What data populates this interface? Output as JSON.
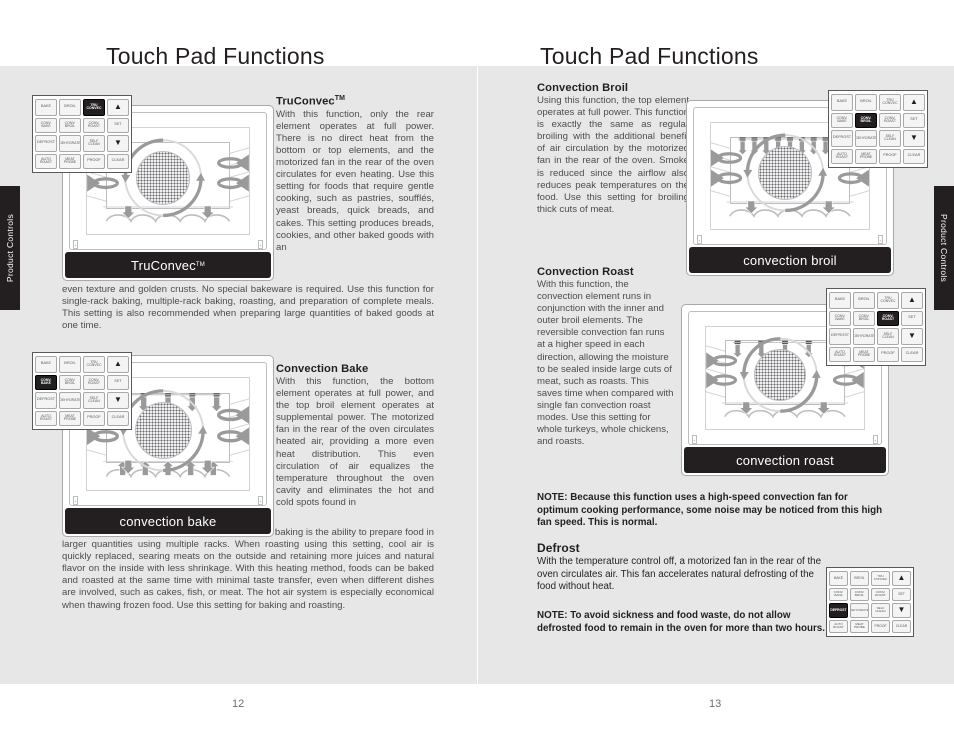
{
  "document": {
    "side_tab_left": "Product Controls",
    "side_tab_right": "Product Controls"
  },
  "left_page": {
    "heading": "Touch Pad Functions",
    "folio": "12",
    "sections": [
      {
        "title": "TruConvec",
        "title_sup": "TM",
        "column_text": "With this function, only the rear element operates at full power. There is no direct heat from the bottom or top elements, and the motorized fan in the rear of the oven circulates for even heating. Use this setting for foods that require gentle cooking, such as pastries, soufflés, yeast breads, quick breads, and cakes. This setting produces breads, cookies, and other baked goods with an",
        "full_text": "even texture and golden crusts. No special bakeware is required. Use this function for single-rack baking, multiple-rack baking, roasting, and preparation of complete meals. This setting is also recommended when preparing large quantities of baked goods at one time."
      },
      {
        "title": "Convection Bake",
        "column_text": "With this function, the bottom element operates at full power, and the top broil element operates at supplemental power. The motorized fan in the rear of the oven circulates heated air, providing a more even heat distribution. This even circulation of air equalizes the temperature throughout the oven cavity and eliminates the hot and cold spots found in",
        "full_text": "conventional ovens. A major benefit of convection baking is the ability to prepare food in larger quantities using multiple racks. When roasting using this setting, cool air is quickly replaced, searing meats on the outside and retaining more juices and natural flavor on the inside with less shrinkage. With this heating method, foods can be baked and roasted at the same time with minimal taste transfer, even when different dishes are involved, such as cakes, fish, or meat. The hot air system is especially economical when thawing frozen food. Use this setting for baking and roasting."
      }
    ],
    "illustrations": [
      {
        "label": "TruConvec",
        "label_sup": "TM"
      },
      {
        "label": "convection bake",
        "label_sup": ""
      }
    ]
  },
  "right_page": {
    "heading": "Touch Pad Functions",
    "folio": "13",
    "sections": [
      {
        "title": "Convection Broil",
        "column_text": "Using this function, the top element operates at full power. This function is exactly the same as regular broiling with the additional benefit of air circulation by the motorized fan in the rear of the oven. Smoke is reduced since the airflow also reduces peak temperatures on the food. Use this setting for broiling thick cuts of meat."
      },
      {
        "title": "Convection Roast",
        "column_text": "With this function, the convection element runs in conjunction with the inner and outer broil elements. The reversible convection fan runs at a higher speed in each direction, allowing the moisture to be sealed inside large cuts of meat, such as roasts. This saves time when compared with single fan convection roast modes. Use this setting for whole turkeys, whole chickens, and roasts."
      },
      {
        "title": "Defrost",
        "column_text": "With the temperature control off, a motorized fan in the rear of the oven circulates air. This fan accelerates natural defrosting of the food without heat."
      }
    ],
    "notes": [
      "NOTE:  Because this function uses a high-speed convection fan for optimum cooking performance, some noise may be noticed from this high fan speed. This is normal.",
      "NOTE: To avoid sickness and food waste, do not allow defrosted food to remain in the oven for more than two hours."
    ],
    "illustrations": [
      {
        "label": "convection broil",
        "label_sup": ""
      },
      {
        "label": "convection roast",
        "label_sup": ""
      }
    ]
  },
  "keypad": {
    "keys": [
      "BAKE",
      "BROIL",
      "TRU\nCONVEC",
      "▲",
      "CONV.\nBAKE",
      "CONV.\nBROIL",
      "CONV.\nROAST",
      "SET",
      "DEFROST",
      "DEHYDRATE",
      "SELF\nCLEAN",
      "▼",
      "AUTO\nROAST",
      "MEAT\nPROBE",
      "PROOF",
      "CLEAR"
    ],
    "panels": [
      {
        "id": "panel-truconvec",
        "active_index": 2
      },
      {
        "id": "panel-convbake",
        "active_index": 4
      },
      {
        "id": "panel-convbroil",
        "active_index": 5
      },
      {
        "id": "panel-convroast",
        "active_index": 6
      },
      {
        "id": "panel-defrost",
        "active_index": 8
      }
    ]
  },
  "colors": {
    "page_background": "#ffffff",
    "band_background": "#e7e7e7",
    "tab_background": "#231f20",
    "label_bar": "#231f20",
    "body_text": "#4d4d4f",
    "heading_text": "#231f20",
    "arrow_fill": "#9a9a9a"
  }
}
